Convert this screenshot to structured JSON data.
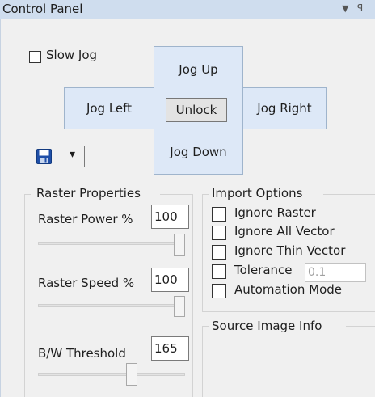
{
  "titlebar": {
    "title": "Control Panel",
    "dropdown_icon": "▼",
    "pin_icon": "ꟼ"
  },
  "jog": {
    "slow_jog_label": "Slow Jog",
    "slow_jog_checked": false,
    "up": "Jog Up",
    "left": "Jog Left",
    "unlock": "Unlock",
    "right": "Jog Right",
    "down": "Jog Down"
  },
  "save_button": {
    "icon": "floppy-disk-icon",
    "arrow": "▾"
  },
  "raster": {
    "group_title": "Raster Properties",
    "power_label": "Raster Power %",
    "power_value": "100",
    "power_slider": 1.0,
    "speed_label": "Raster Speed %",
    "speed_value": "100",
    "speed_slider": 1.0,
    "threshold_label": "B/W Threshold",
    "threshold_value": "165",
    "threshold_slider": 0.65
  },
  "import": {
    "group_title": "Import Options",
    "ignore_raster": "Ignore Raster",
    "ignore_all_vector": "Ignore All Vector",
    "ignore_thin_vector": "Ignore Thin Vector",
    "tolerance_label": "Tolerance",
    "tolerance_value": "0.1",
    "automation_mode": "Automation Mode"
  },
  "source_info": {
    "group_title": "Source Image Info"
  },
  "colors": {
    "title_bg": "#cfddee",
    "jog_bg": "#dde8f7",
    "panel_bg": "#f0f0f0",
    "save_icon_blue": "#1f4fa8"
  }
}
